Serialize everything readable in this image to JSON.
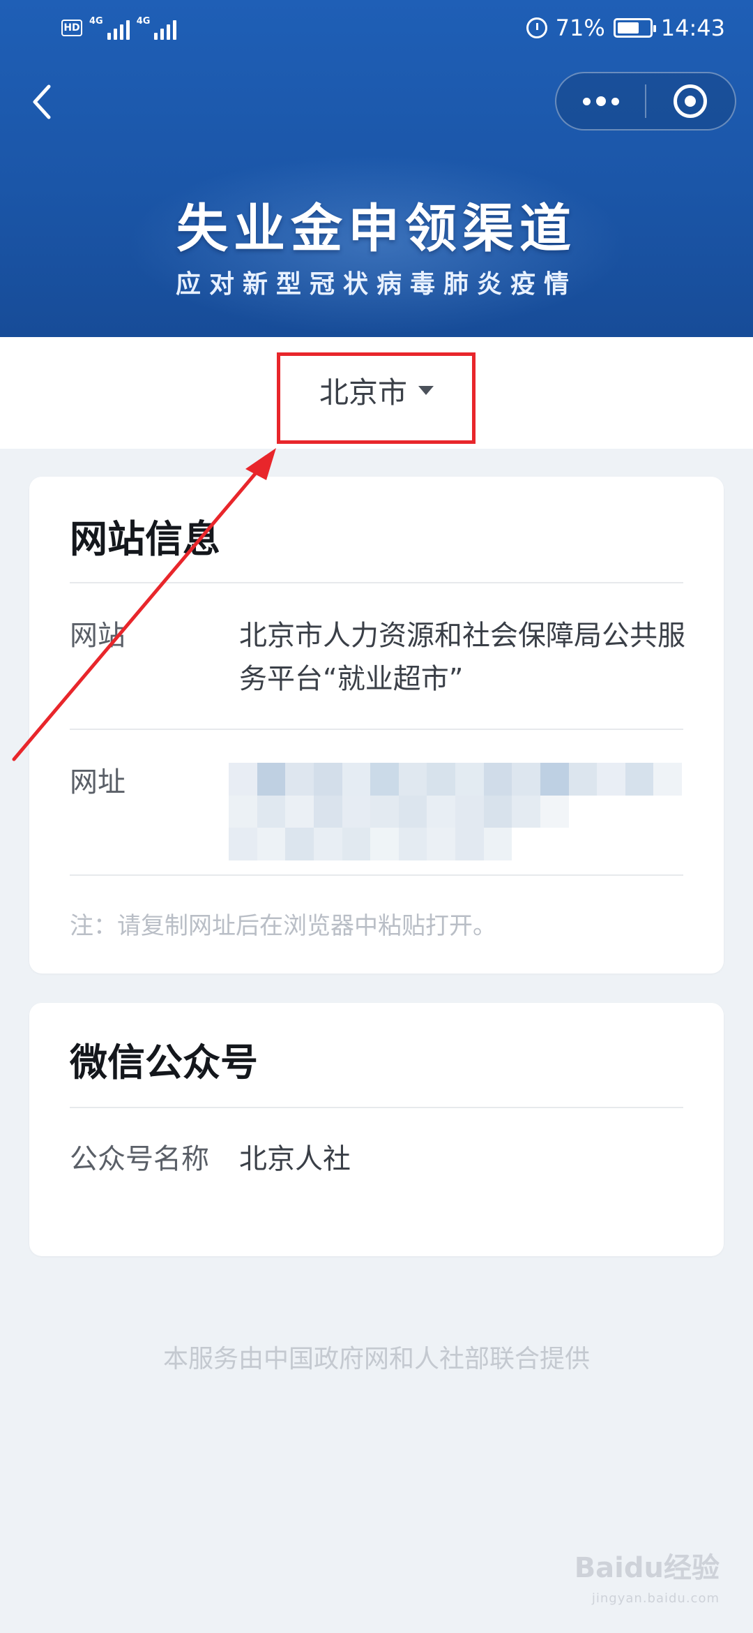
{
  "status_bar": {
    "network_left": "4G",
    "network_right": "4G",
    "hd_label": "HD",
    "battery_percent": "71%",
    "time": "14:43"
  },
  "header": {
    "title": "失业金申领渠道",
    "subtitle": "应对新型冠状病毒肺炎疫情"
  },
  "city_selector": {
    "city": "北京市"
  },
  "website_card": {
    "title": "网站信息",
    "site_label": "网站",
    "site_value": "北京市人力资源和社会保障局公共服务平台“就业超市”",
    "url_label": "网址",
    "note": "注：请复制网址后在浏览器中粘贴打开。"
  },
  "wechat_card": {
    "title": "微信公众号",
    "account_label": "公众号名称",
    "account_value": "北京人社"
  },
  "footer": {
    "text": "本服务由中国政府网和人社部联合提供"
  },
  "watermark": {
    "text": "Baidu经验",
    "sub": "jingyan.baidu.com"
  },
  "colors": {
    "header_blue": "#1b56a8",
    "highlight_red": "#e8262b",
    "page_bg": "#eef2f6"
  }
}
